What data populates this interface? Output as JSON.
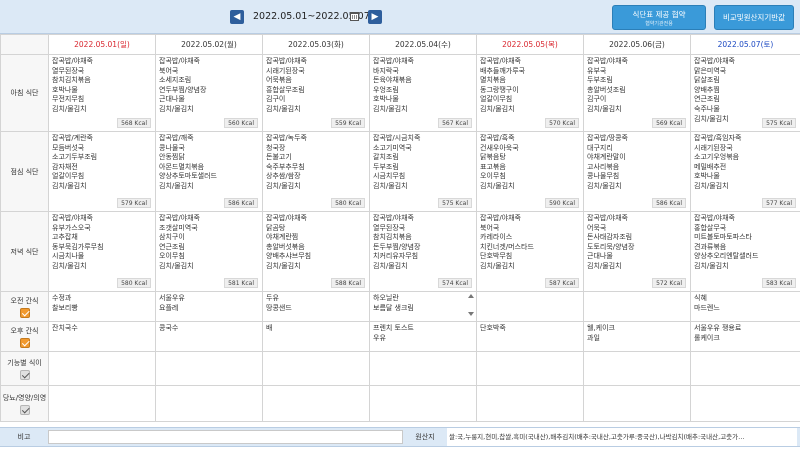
{
  "header": {
    "prev_icon": "chevron-left-icon",
    "next_icon": "chevron-right-icon",
    "prev_glyph": "◀",
    "next_glyph": "▶",
    "date_range": "2022.05.01~2022.05.07",
    "calendar_icon": "calendar-icon",
    "provide_button": {
      "line1": "식단표 제공 협약",
      "line2": "협약기관전용"
    },
    "compare_button": "비교및원산지기반값"
  },
  "days": [
    {
      "label": "2022.05.01(일)",
      "kind": "sun"
    },
    {
      "label": "2022.05.02(월)",
      "kind": "wk"
    },
    {
      "label": "2022.05.03(화)",
      "kind": "wk"
    },
    {
      "label": "2022.05.04(수)",
      "kind": "wk"
    },
    {
      "label": "2022.05.05(목)",
      "kind": "holiday"
    },
    {
      "label": "2022.05.06(금)",
      "kind": "wk"
    },
    {
      "label": "2022.05.07(토)",
      "kind": "sat"
    }
  ],
  "rows": {
    "breakfast": "아침 식단",
    "lunch": "점심 식단",
    "dinner": "저녁 식단",
    "am_snack": "오전 간식",
    "pm_snack": "오후 간식",
    "by_function": "기능별 식이",
    "diabetic": "당뇨/영양/의영"
  },
  "breakfast": [
    {
      "items": [
        "잡곡밥/야채죽",
        "열무된장국",
        "참치김치볶음",
        "호박나물",
        "무전지무침",
        "김치/물김치"
      ],
      "kcal": "568 Kcal"
    },
    {
      "items": [
        "잡곡밥/야채죽",
        "북어국",
        "소세지조림",
        "연두부찜/양념장",
        "근대나물",
        "김치/물김치"
      ],
      "kcal": "560 Kcal"
    },
    {
      "items": [
        "잡곡밥/야채죽",
        "시래기된장국",
        "어묵볶음",
        "흥합살무조림",
        "김구이",
        "김치/물김치"
      ],
      "kcal": "559 Kcal"
    },
    {
      "items": [
        "잡곡밥/야채죽",
        "바지락국",
        "돈육야채볶음",
        "우엉조림",
        "호박나물",
        "김치/물김치"
      ],
      "kcal": "567 Kcal"
    },
    {
      "items": [
        "잡곡밥/야채죽",
        "배추들깨가루국",
        "멸치볶음",
        "동그랑땡구이",
        "얼갈이무침",
        "김치/물김치"
      ],
      "kcal": "570 Kcal"
    },
    {
      "items": [
        "잡곡밥/야채죽",
        "유부국",
        "두부조림",
        "총알버섯조림",
        "김구이",
        "김치/물김치"
      ],
      "kcal": "569 Kcal"
    },
    {
      "items": [
        "잡곡밥/야채죽",
        "맑은미역국",
        "닭살조림",
        "양배추찜",
        "연근조림",
        "숙주나물",
        "김치/물김치"
      ],
      "kcal": "575 Kcal"
    }
  ],
  "lunch": [
    {
      "items": [
        "잡곡밥/계란죽",
        "모듬버섯국",
        "소고기두부조림",
        "감자채전",
        "얼갈이무침",
        "김치/물김치"
      ],
      "kcal": "579 Kcal"
    },
    {
      "items": [
        "잡곡밥/깨죽",
        "콩나물국",
        "안동찜닭",
        "아몬드멸치볶음",
        "양상추토마토샐러드",
        "김치/물김치"
      ],
      "kcal": "586 Kcal"
    },
    {
      "items": [
        "잡곡밥/녹두죽",
        "청국장",
        "돈불고기",
        "숙주부추무침",
        "상추쌈/쌈장",
        "김치/물김치"
      ],
      "kcal": "580 Kcal"
    },
    {
      "items": [
        "잡곡밥/시금치죽",
        "소고기미역국",
        "갈치조림",
        "두부조림",
        "시금치무침",
        "김치/물김치"
      ],
      "kcal": "575 Kcal"
    },
    {
      "items": [
        "잡곡밥/흑죽",
        "건새우아욱국",
        "닭볶음탕",
        "표고볶음",
        "오이무침",
        "김치/물김치"
      ],
      "kcal": "590 Kcal"
    },
    {
      "items": [
        "잡곡밥/땅콩죽",
        "대구지리",
        "야채계란말이",
        "고사리볶음",
        "콩나물무침",
        "김치/물김치"
      ],
      "kcal": "586 Kcal"
    },
    {
      "items": [
        "잡곡밥/흑임자죽",
        "시래기된장국",
        "소고기우엉볶음",
        "메밀배추전",
        "호박나물",
        "김치/물김치"
      ],
      "kcal": "577 Kcal"
    }
  ],
  "dinner": [
    {
      "items": [
        "잡곡밥/야채죽",
        "유부가스오국",
        "고추잡채",
        "동부묵김가루무침",
        "시금치나물",
        "김치/물김치"
      ],
      "kcal": "580 Kcal"
    },
    {
      "items": [
        "잡곡밥/야채죽",
        "조갯살미역국",
        "삼치구이",
        "연근조림",
        "오이무침",
        "김치/물김치"
      ],
      "kcal": "581 Kcal"
    },
    {
      "items": [
        "잡곡밥/야채죽",
        "닭곰탕",
        "야채계란찜",
        "총알버섯볶음",
        "양배추샤브무침",
        "김치/물김치"
      ],
      "kcal": "588 Kcal"
    },
    {
      "items": [
        "잡곡밥/야채죽",
        "열무된장국",
        "참치김치볶음",
        "돈두부찜/양념장",
        "치커리유자무침",
        "김치/물김치"
      ],
      "kcal": "574 Kcal"
    },
    {
      "items": [
        "잡곡밥/야채죽",
        "북어국",
        "카레라이스",
        "치킨너겟/머스타드",
        "단호박무침",
        "김치/물김치"
      ],
      "kcal": "587 Kcal"
    },
    {
      "items": [
        "잡곡밥/야채죽",
        "어묵국",
        "돈사태감자조림",
        "도토리묵/양념장",
        "근대나물",
        "김치/물김치"
      ],
      "kcal": "572 Kcal"
    },
    {
      "items": [
        "잡곡밥/야채죽",
        "홍합살무국",
        "미트볼토마토파스타",
        "견과류볶음",
        "양상추오리엔탈샐러드",
        "김치/물김치"
      ],
      "kcal": "583 Kcal"
    }
  ],
  "am_snack": [
    [
      "수정과",
      "찰보리빵"
    ],
    [
      "서울우유",
      "요플레"
    ],
    [
      "두유",
      "땅콩샌드"
    ],
    [
      "하오닐란",
      "보름달 생크림"
    ],
    [],
    [],
    [
      "식혜",
      "마드렌느"
    ]
  ],
  "pm_snack": [
    [
      "잔치국수"
    ],
    [
      "콩국수"
    ],
    [
      "배"
    ],
    [
      "프렌치 토스트",
      "우유"
    ],
    [
      "단호박죽"
    ],
    [
      "웰,케이크",
      "과일"
    ],
    [
      "서울우유 쟁용료",
      "롤케이크"
    ]
  ],
  "footer": {
    "note_label": "비고",
    "origin_label": "원산지",
    "origin_text": "쌀:국,누룽지,현미,찹쌀,흑미(국내산),배추김치(배추:국내산,고춧가루:중국산),나박김치(배추:국내산,고춧가…"
  }
}
